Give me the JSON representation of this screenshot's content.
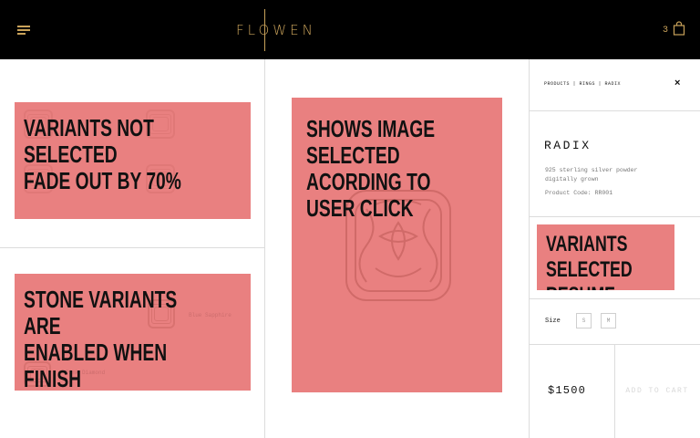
{
  "header": {
    "logo": "FLOWEN",
    "cart_count": "3",
    "menu_icon": "hamburger-menu-icon",
    "cart_icon": "shopping-bag-icon",
    "brand_color": "#c9a25a",
    "background": "#000000"
  },
  "annotations": {
    "color": "#e98080",
    "finish_note": "VARIANTS NOT SELECTED\nFADE OUT BY 70%",
    "stone_note": "STONE VARIANTS ARE\nENABLED WHEN FINISH\nIS SELECTED",
    "image_note": "SHOWS IMAGE SELECTED\nACORDING TO USER CLICK",
    "resume_note": "VARIANTS\nSELECTED RESUME",
    "stone_option_1": "Blue Sapphire",
    "stone_option_2": "Pink Diamond"
  },
  "product": {
    "breadcrumb": "PRODUCTS | RINGS | RADIX",
    "close": "×",
    "title": "RADIX",
    "description": "925 sterling silver powder digitally grown",
    "code": "Product Code: RR001",
    "size_label": "Size",
    "sizes": [
      "S",
      "M"
    ],
    "price": "$1500",
    "add_to_cart": "ADD TO CART"
  }
}
